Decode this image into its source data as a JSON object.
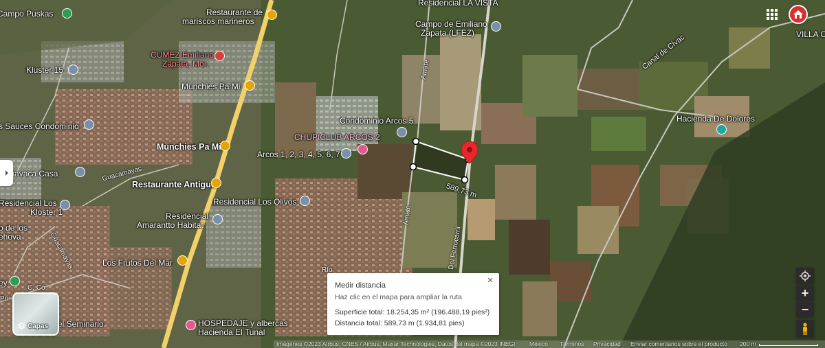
{
  "places": {
    "campo_puskas": "Campo Puskas",
    "restaurante_mariscos_1": "Restaurante de",
    "restaurante_mariscos_2": "mariscos  marineros",
    "residencial_la_vista": "Residencial LA VISTA",
    "campo_emiliano_1": "Campo de Emiliano",
    "campo_emiliano_2": "Zapata (LFEZ)",
    "cumez_1": "CUMEZ Emiliano",
    "cumez_2": "Zapata, Mor.",
    "kluster_15": "Kluster 15",
    "munchies_1": "Munchies Pa Mi",
    "canal_de_civac": "Canal de Civac",
    "villa": "VILLA C",
    "hacienda_dolores": "Hacienda De Dolores",
    "sauces": "s Sauces Condominio",
    "condominio_arcos": "Condominio Arcos 5",
    "chupiclub": "CHUPICLUB ARCOS 2",
    "munchies_2": "Munchies Pa Mi",
    "arcos": "Arcos 1, 2, 3, 4, 5, 6, 7",
    "cuernavaca_casa": "uernavaca Casa",
    "guacamayas": "Guacamayas",
    "restaurante_antiguo": "Restaurante Antiguo",
    "residencial_los_1": "Residencial Los",
    "residencial_los_2": "Kloster 1",
    "residencial_olivos": "Residencial Los Olivos",
    "residencial_amarantto_1": "Residencial",
    "residencial_amarantto_2": "Amarantto Habitat",
    "de_los_1": "o de los",
    "de_los_2": "ehova",
    "los_frutos": "Los Frutos Del Mar",
    "guacamayas_2": "Guacamayas",
    "el_seminario": "el Seminario",
    "hospedaje_1": "HOSPEDAJE y albercas",
    "hospedaje_2": "Hacienda El Tunal",
    "amate_1": "Amate",
    "amate_2": "Amate",
    "ferrocarril": "Del Ferrocarril",
    "rio": "Río",
    "ey": "ey",
    "pri": "Pri",
    "co": "C. Co"
  },
  "measurement_line_label": "589,73 m",
  "measure_panel": {
    "title": "Medir distancia",
    "hint": "Haz clic en el mapa para ampliar la ruta",
    "area": "Superficie total: 18.254,35 m² (196.488,19 pies²)",
    "distance": "Distancia total: 589,73 m (1.934,81 pies)",
    "close": "×"
  },
  "layers": {
    "label": "Capas"
  },
  "footer": {
    "attribution": "Imágenes ©2023 Airbus, CNES / Airbus, Maxar Technologies, Datos del mapa ©2023 INEGI",
    "country": "México",
    "terms": "Términos",
    "privacy": "Privacidad",
    "feedback": "Enviar comentarios sobre el producto",
    "scale": "200 m"
  },
  "controls": {
    "zoom_in": "+",
    "zoom_out": "−"
  },
  "colors": {
    "pin_red": "#e8272c",
    "route_white": "#ffffff",
    "road_yellow": "#f2d16b"
  },
  "icons": [
    "apps-grid-icon",
    "account-avatar-icon",
    "locate-me-icon",
    "pegman-icon",
    "layers-icon",
    "expand-arrow-icon",
    "close-icon"
  ]
}
